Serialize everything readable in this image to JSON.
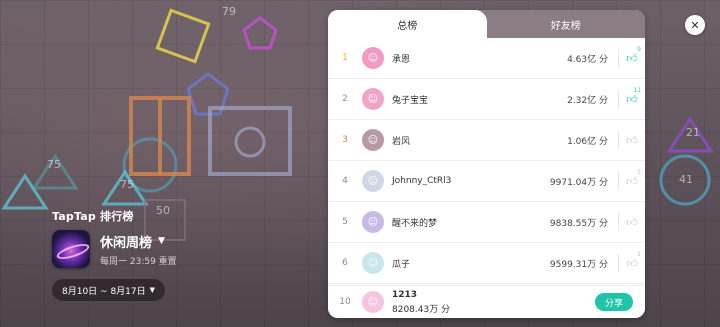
{
  "leaderboard": {
    "tabs": [
      {
        "label": "总榜",
        "active": true
      },
      {
        "label": "好友榜",
        "active": false
      }
    ],
    "rows": [
      {
        "rank": "1",
        "name": "承恩",
        "score": "4.63亿 分",
        "likes": "9",
        "liked": true,
        "avatar_color": "#f29bc2",
        "avatar_glyph": "☺"
      },
      {
        "rank": "2",
        "name": "兔子宝宝",
        "score": "2.32亿 分",
        "likes": "11",
        "liked": true,
        "avatar_color": "#f0a5c8",
        "avatar_glyph": "☺"
      },
      {
        "rank": "3",
        "name": "岩风",
        "score": "1.06亿 分",
        "likes": "",
        "liked": false,
        "avatar_color": "#b79aa5",
        "avatar_glyph": "☺"
      },
      {
        "rank": "4",
        "name": "Johnny_CtRl3",
        "score": "9971.04万 分",
        "likes": "5",
        "liked": false,
        "avatar_color": "#cfd6e6",
        "avatar_glyph": "☺"
      },
      {
        "rank": "5",
        "name": "醒不来的梦",
        "score": "9838.55万 分",
        "likes": "",
        "liked": false,
        "avatar_color": "#c8b9e6",
        "avatar_glyph": "☺"
      },
      {
        "rank": "6",
        "name": "瓜子",
        "score": "9599.31万 分",
        "likes": "1",
        "liked": false,
        "avatar_color": "#c9e7ea",
        "avatar_glyph": "☺"
      }
    ],
    "me": {
      "rank": "10",
      "name": "1213",
      "score": "8208.43万 分",
      "avatar_color": "#f6c4df",
      "avatar_glyph": "☺"
    },
    "share_label": "分享"
  },
  "info": {
    "brand": "TapTap 排行榜",
    "board_title": "休闲周榜",
    "reset_note": "每周一 23:59 重置",
    "date_range": "8月10日 ~ 8月17日"
  },
  "colors": {
    "accent": "#20c4a6",
    "gold": "#e0b22b",
    "silver": "#8d96a7",
    "bronze": "#c98a49"
  }
}
